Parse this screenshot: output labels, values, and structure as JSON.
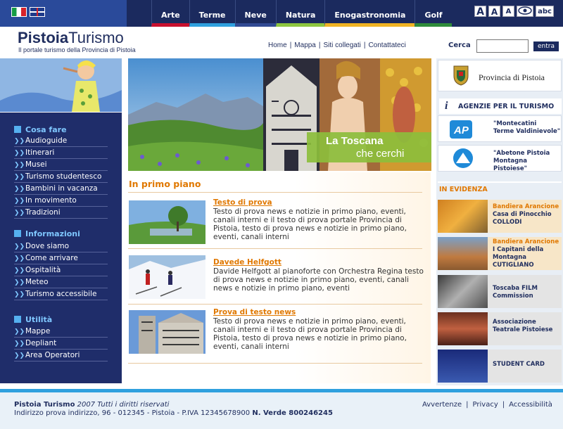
{
  "accessibility": {
    "font_a1": "A",
    "font_a2": "A",
    "font_a3": "A",
    "abc": "abc"
  },
  "nav": [
    "Arte",
    "Terme",
    "Neve",
    "Natura",
    "Enogastronomia",
    "Golf"
  ],
  "header": {
    "logo_bold": "Pistoia",
    "logo_light": "Turismo",
    "logo_sub": "Il portale turismo della Provincia di Pistoia",
    "links": [
      "Home",
      "|",
      "Mappa",
      "|",
      "Siti collegati",
      "|",
      "Contattateci"
    ],
    "search_label": "Cerca",
    "search_value": "",
    "search_button": "entra"
  },
  "sidebar": {
    "sections": [
      {
        "title": "Cosa fare",
        "items": [
          "Audioguide",
          "Itinerari",
          "Musei",
          "Turismo studentesco",
          "Bambini in vacanza",
          "In movimento",
          "Tradizioni"
        ]
      },
      {
        "title": "Informazioni",
        "items": [
          "Dove siamo",
          "Come arrivare",
          "Ospitalità",
          "Meteo",
          "Turismo accessibile"
        ]
      },
      {
        "title": "Utilità",
        "items": [
          "Mappe",
          "Depliant",
          "Area Operatori"
        ]
      }
    ]
  },
  "hero": {
    "line1": "La Toscana",
    "line2": "che cerchi"
  },
  "main": {
    "section_title": "In primo piano",
    "news": [
      {
        "title": "Testo di prova",
        "body": "Testo di prova news e notizie in primo piano, eventi, canali interni e il testo di prova portale Provincia di Pistoia, testo di prova news e notizie in primo piano, eventi, canali interni"
      },
      {
        "title": "Davede Helfgott",
        "body": "Davide Helfgott al pianoforte con Orchestra Regina testo di prova news e notizie in primo piano, eventi, canali  news e notizie in primo piano, eventi"
      },
      {
        "title": "Prova di testo news",
        "body": "Testo di prova news e notizie in primo piano, eventi, canali interni e il testo di prova portale Provincia di Pistoia, testo di prova news e notizie in primo piano, eventi, canali interni"
      }
    ]
  },
  "right": {
    "provincia": "Provincia di Pistoia",
    "agenzie_title": "AGENZIE PER IL TURISMO",
    "agenzie": [
      {
        "line1": "\"Montecatini",
        "line2": "Terme Valdinievole\""
      },
      {
        "line1": "\"Abetone Pistoia",
        "line2": "Montagna Pistoiese\""
      }
    ],
    "evidenza_title": "IN EVIDENZA",
    "evidenza": [
      {
        "tag": "Bandiera Arancione",
        "lines": [
          "Casa di Pinocchio",
          "COLLODI"
        ]
      },
      {
        "tag": "Bandiera Arancione",
        "lines": [
          "I Capitani della",
          "Montagna",
          "CUTIGLIANO"
        ]
      },
      {
        "tag": "",
        "lines": [
          "Toscaba FILM",
          "Commission"
        ]
      },
      {
        "tag": "",
        "lines": [
          "Associazione",
          "Teatrale Pistoiese"
        ]
      },
      {
        "tag": "",
        "lines": [
          "STUDENT CARD"
        ]
      }
    ]
  },
  "footer": {
    "brand": "Pistoia Turismo",
    "copyright": "2007 Tutti i diritti riservati",
    "address": "Indirizzo prova indirizzo, 96 - 012345 - Pistoia - P.IVA 12345678900",
    "verde": "N. Verde 800246245",
    "links": [
      "Avvertenze",
      "|",
      "Privacy",
      "|",
      "Accessibilità"
    ]
  }
}
